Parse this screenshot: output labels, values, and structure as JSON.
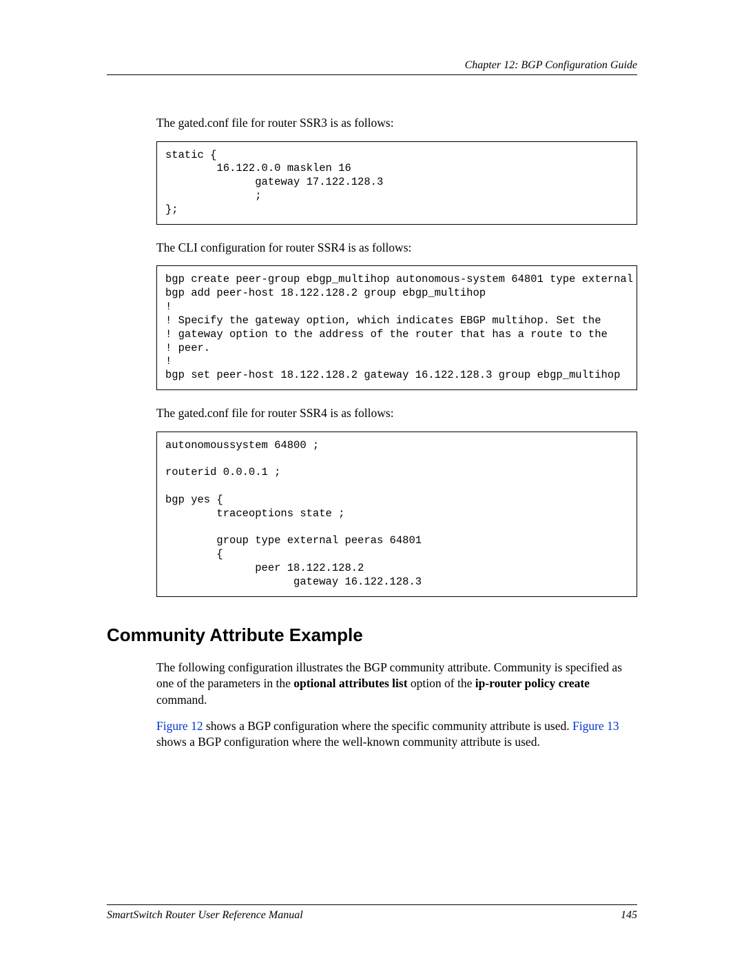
{
  "header": {
    "chapter": "Chapter 12: BGP Configuration Guide"
  },
  "para1": "The gated.conf file for router SSR3 is as follows:",
  "code1": "static {\n        16.122.0.0 masklen 16\n              gateway 17.122.128.3\n              ;\n};",
  "para2": "The CLI configuration for router SSR4 is as follows:",
  "code2": "bgp create peer-group ebgp_multihop autonomous-system 64801 type external\nbgp add peer-host 18.122.128.2 group ebgp_multihop\n!\n! Specify the gateway option, which indicates EBGP multihop. Set the  \n! gateway option to the address of the router that has a route to the \n! peer. \n!\nbgp set peer-host 18.122.128.2 gateway 16.122.128.3 group ebgp_multihop",
  "para3": "The gated.conf file for router SSR4 is as follows:",
  "code3": "autonomoussystem 64800 ;\n\nrouterid 0.0.0.1 ;\n\nbgp yes {\n        traceoptions state ;\n\n        group type external peeras 64801 \n        {\n              peer 18.122.128.2\n                    gateway 16.122.128.3",
  "section_heading": "Community Attribute Example",
  "para4_parts": {
    "a": "The following configuration illustrates the BGP community attribute. Community is specified as one of the parameters in the ",
    "b": "optional attributes list",
    "c": " option of the ",
    "d": "ip-router policy create",
    "e": " command."
  },
  "para5_parts": {
    "link1": "Figure 12",
    "a": " shows a BGP configuration where the specific community attribute is used. ",
    "link2": "Figure 13",
    "b": " shows a BGP configuration where the well-known community attribute is used."
  },
  "footer": {
    "left": "SmartSwitch Router User Reference Manual",
    "right": "145"
  }
}
